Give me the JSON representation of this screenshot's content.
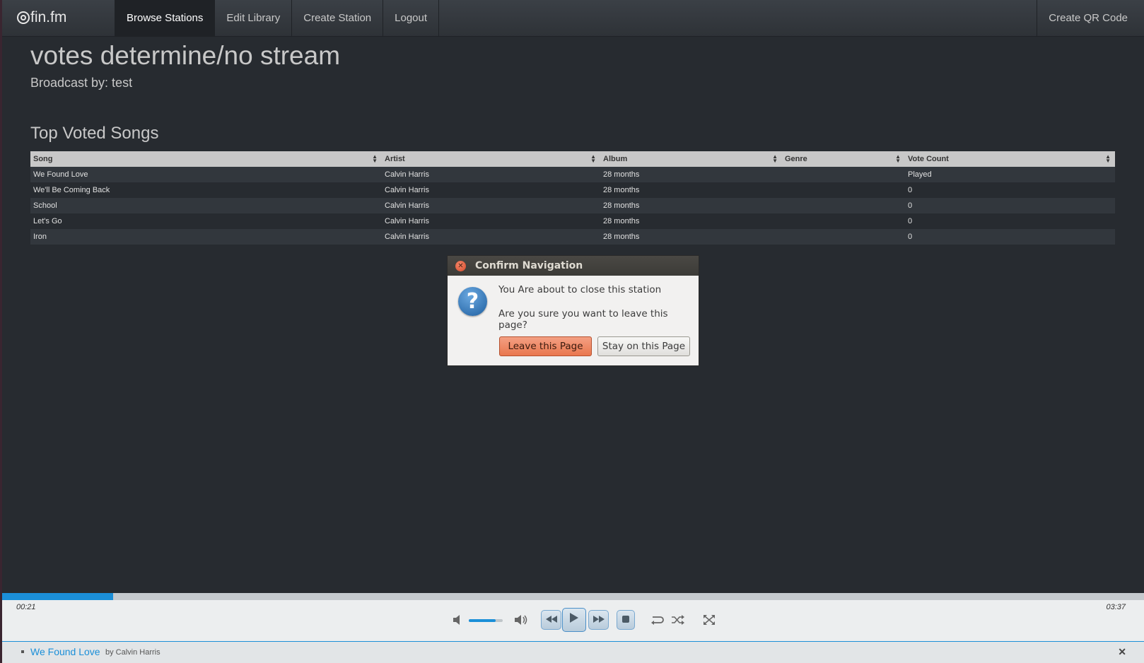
{
  "navbar": {
    "brand": "fin.fm",
    "items": [
      {
        "label": "Browse Stations"
      },
      {
        "label": "Edit Library"
      },
      {
        "label": "Create Station"
      },
      {
        "label": "Logout"
      }
    ],
    "right_item": "Create QR Code"
  },
  "station": {
    "title": "votes determine/no stream",
    "broadcaster": "Broadcast by: test"
  },
  "songs_section": {
    "title": "Top Voted Songs",
    "columns": [
      "Song",
      "Artist",
      "Album",
      "Genre",
      "Vote Count"
    ],
    "rows": [
      [
        "We Found Love",
        "Calvin Harris",
        "28 months",
        "",
        "Played"
      ],
      [
        "We'll Be Coming Back",
        "Calvin Harris",
        "28 months",
        "",
        "0"
      ],
      [
        "School",
        "Calvin Harris",
        "28 months",
        "",
        "0"
      ],
      [
        "Let's Go",
        "Calvin Harris",
        "28 months",
        "",
        "0"
      ],
      [
        "Iron",
        "Calvin Harris",
        "28 months",
        "",
        "0"
      ]
    ]
  },
  "dialog": {
    "title": "Confirm Navigation",
    "message1": "You Are about to close this station",
    "message2": "Are you sure you want to leave this page?",
    "leave_label": "Leave this Page",
    "stay_label": "Stay on this Page"
  },
  "player": {
    "current_time": "00:21",
    "duration": "03:37",
    "progress": 0.097,
    "volume": 0.8,
    "now_playing_song": "We Found Love",
    "now_playing_artist": "by Calvin Harris",
    "accent_color": "#1b8fd8"
  }
}
